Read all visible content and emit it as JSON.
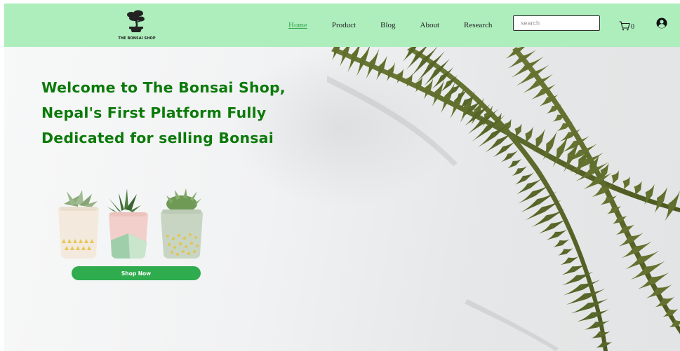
{
  "brand": {
    "name": "THE BONSAI SHOP"
  },
  "nav": {
    "links": [
      {
        "label": "Home",
        "active": true
      },
      {
        "label": "Product",
        "active": false
      },
      {
        "label": "Blog",
        "active": false
      },
      {
        "label": "About",
        "active": false
      },
      {
        "label": "Research",
        "active": false
      }
    ]
  },
  "search": {
    "placeholder": "search",
    "value": ""
  },
  "cart": {
    "count": "0",
    "icon": "cart-icon"
  },
  "profile": {
    "icon": "user-icon"
  },
  "hero": {
    "title_lines": [
      "Welcome to The Bonsai Shop,",
      "Nepal's First Platform Fully",
      "Dedicated for selling Bonsai"
    ],
    "cta_label": "Shop Now",
    "image": "fern-leaf-illustration",
    "products_image": "three-succulent-pots"
  },
  "colors": {
    "nav_background": "#aeeebd",
    "title_green": "#0c7a0a",
    "button_green": "#2fac4e",
    "active_link": "#37a64d"
  }
}
